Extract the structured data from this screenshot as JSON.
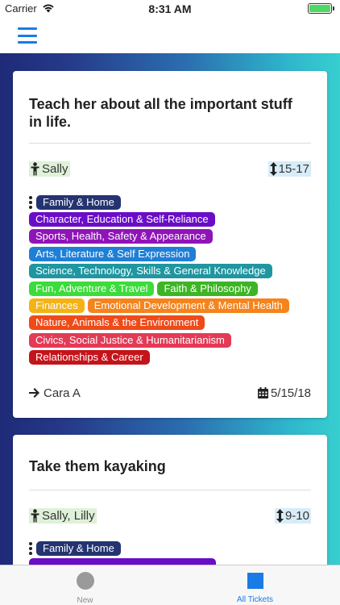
{
  "status": {
    "carrier": "Carrier",
    "time": "8:31 AM"
  },
  "nav": {
    "menu_icon": "hamburger-menu-icon"
  },
  "tickets": [
    {
      "title": "Teach her about all the important stuff in life.",
      "people": "Sally",
      "age": "15-17",
      "tags": [
        "Family & Home",
        "Character, Education & Self-Reliance",
        "Sports, Health, Safety & Appearance",
        "Arts, Literature & Self Expression",
        "Science, Technology, Skills & General Knowledge",
        "Fun, Adventure & Travel",
        "Faith & Philosophy",
        "Finances",
        "Emotional Development & Mental Health",
        "Nature, Animals & the Environment",
        "Civics, Social Justice & Humanitarianism",
        "Relationships & Career"
      ],
      "assignee": "Cara A",
      "date": "5/15/18"
    },
    {
      "title": "Take them kayaking",
      "people": "Sally, Lilly",
      "age": "9-10",
      "tags": [
        "Family & Home"
      ]
    }
  ],
  "tag_colors": {
    "Family & Home": "#253370",
    "Character, Education & Self-Reliance": "#6a0dc7",
    "Sports, Health, Safety & Appearance": "#8f14b8",
    "Arts, Literature & Self Expression": "#1f7fd6",
    "Science, Technology, Skills & General Knowledge": "#1f96a0",
    "Fun, Adventure & Travel": "#3bdc3b",
    "Faith & Philosophy": "#3cb524",
    "Finances": "#f4b315",
    "Emotional Development & Mental Health": "#f5841e",
    "Nature, Animals & the Environment": "#ef4a18",
    "Civics, Social Justice & Humanitarianism": "#e33a56",
    "Relationships & Career": "#c4141b"
  },
  "tabbar": {
    "tabs": [
      {
        "label": "New",
        "icon": "circle-icon"
      },
      {
        "label": "All Tickets",
        "icon": "square-icon"
      }
    ]
  }
}
